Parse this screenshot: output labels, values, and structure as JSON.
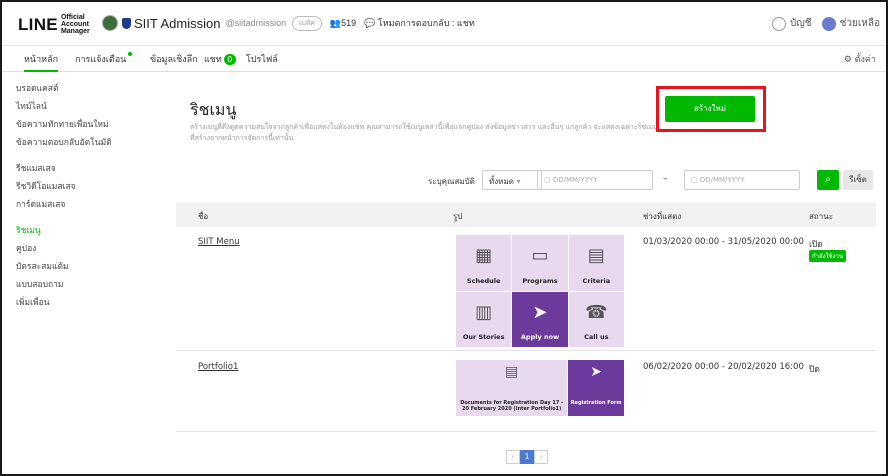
{
  "header": {
    "logo_text": "LINE",
    "logo_sub": "Official Account Manager",
    "account_name": "SIIT Admission",
    "account_id": "@siitadmission",
    "account_pill": "เบสิค",
    "followers": "519",
    "mode": "โหมดการตอบกลับ : แชท",
    "user_label": "บัญชี",
    "help_label": "ช่วยเหลือ"
  },
  "nav": {
    "tabs": [
      "หน้าหลัก",
      "การแจ้งเตือน",
      "ข้อมูลเชิงลึก",
      "แชท",
      "โปรไฟล์"
    ],
    "chat_badge": "0",
    "settings_label": "ตั้งค่า"
  },
  "sidebar": {
    "group1": [
      "บรอดแคสต์",
      "ไทม์ไลน์",
      "ข้อความทักทายเพื่อนใหม่",
      "ข้อความตอบกลับอัตโนมัติ"
    ],
    "group2": [
      "รีชแมสเสจ",
      "รีชวิดีโอแมสเสจ",
      "การ์ดแมสเสจ"
    ],
    "group3": [
      "ริชเมนู",
      "คูปอง",
      "บัตรสะสมแต้ม",
      "แบบสอบถาม",
      "เพิ่มเพื่อน"
    ]
  },
  "main": {
    "title": "ริชเมนู",
    "description": "สร้างเมนูที่ดึงดูดความสนใจจากลูกค้าเพื่อแสดงในห้องแชท คุณสามารถใช้เมนูเหล่านี้เพื่อแจกคูปอง ส่งข้อมูลข่าวสาร และอื่นๆ แก่ลูกค้า จะแสดงเฉพาะริชเมนูที่สร้างจากหน้าการจัดการนี้เท่านั้น",
    "create_label": "สร้างใหม่",
    "filter_label": "ระบุคุณสมบัติ",
    "filter_select": "ทั้งหมด",
    "date_placeholder": "DD/MM/YYYY",
    "search_icon": "search-icon",
    "reset_label": "รีเซ็ต",
    "columns": [
      "ชื่อ",
      "รูป",
      "ช่วงที่แสดง",
      "สถานะ"
    ],
    "rows": [
      {
        "name": "SIIT Menu",
        "period": "01/03/2020 00:00 - 31/05/2020 00:00",
        "status": "เปิด",
        "badge": "กำลังใช้งาน",
        "tiles": [
          "Schedule",
          "Programs",
          "Criteria",
          "Our Stories",
          "Apply now",
          "Call us"
        ]
      },
      {
        "name": "Portfolio1",
        "period": "06/02/2020 00:00 - 20/02/2020 16:00",
        "status": "ปิด",
        "tiles": [
          "Documents for Registration Day 17 - 20 February 2020 (Inter Portfolio1)",
          "Registration Form"
        ]
      }
    ],
    "page": "1"
  },
  "colors": {
    "accent": "#00b900",
    "highlight": "#e8141b",
    "tile_light": "#e8d9ef",
    "tile_dark": "#6b3a9a"
  }
}
